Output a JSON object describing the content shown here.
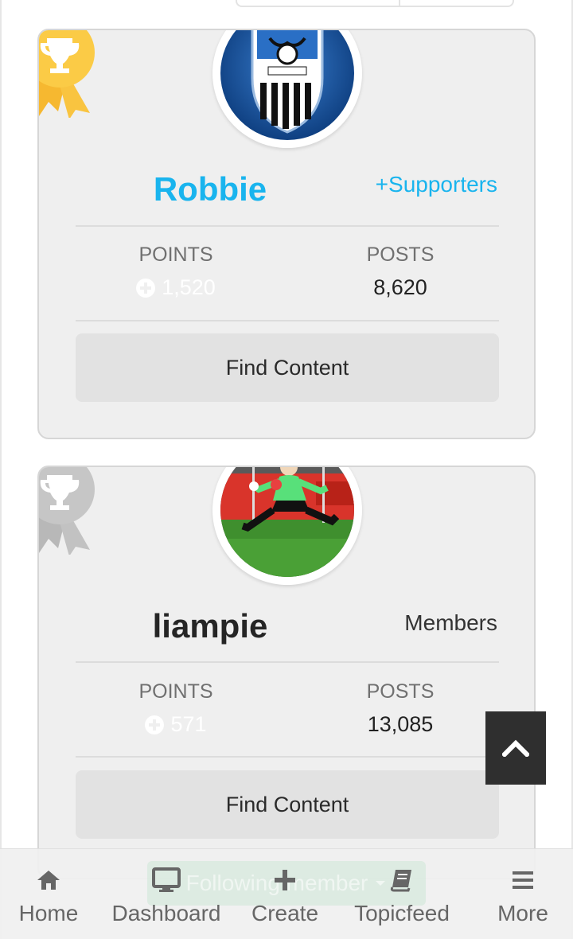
{
  "members": [
    {
      "username": "Robbie",
      "group": "+Supporters",
      "points_label": "POINTS",
      "points": "1,520",
      "posts_label": "POSTS",
      "posts": "8,620",
      "find_content": "Find Content",
      "rank_ribbon": "gold",
      "avatar": "club-crest-avatar"
    },
    {
      "username": "liampie",
      "group": "Members",
      "points_label": "POINTS",
      "points": "571",
      "posts_label": "POSTS",
      "posts": "13,085",
      "find_content": "Find Content",
      "rank_ribbon": "silver",
      "avatar": "goalkeeper-photo-avatar"
    }
  ],
  "toast": {
    "text": "Following member"
  },
  "bottom_nav": [
    {
      "label": "Home",
      "icon": "home-icon"
    },
    {
      "label": "Dashboard",
      "icon": "monitor-icon"
    },
    {
      "label": "Create",
      "icon": "plus-icon"
    },
    {
      "label": "Topicfeed",
      "icon": "book-icon"
    },
    {
      "label": "More",
      "icon": "menu-icon"
    }
  ],
  "colors": {
    "accent": "#19b4ee",
    "gold": "#f9c440",
    "silver": "#c2c2c2"
  }
}
